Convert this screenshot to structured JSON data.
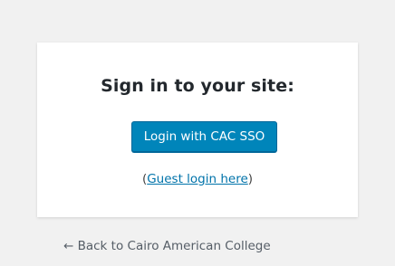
{
  "card": {
    "heading": "Sign in to your site:",
    "sso_button_label": "Login with CAC SSO",
    "guest_prefix": "(",
    "guest_link_text": "Guest login here",
    "guest_suffix": ")"
  },
  "back_link": {
    "text": "← Back to Cairo American College"
  },
  "colors": {
    "background": "#f1f1f1",
    "card": "#ffffff",
    "button": "#0085ba",
    "link": "#0073aa"
  }
}
